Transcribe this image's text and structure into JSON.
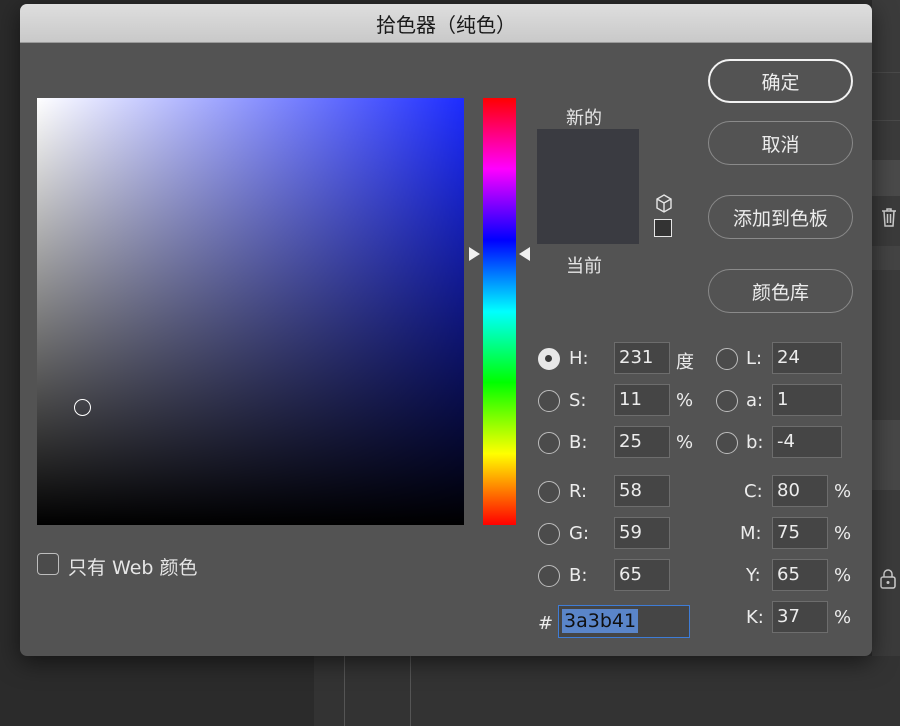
{
  "dialog": {
    "title": "拾色器（纯色）",
    "preview": {
      "new_label": "新的",
      "current_label": "当前",
      "new_color": "#3a3b41"
    },
    "buttons": {
      "ok": "确定",
      "cancel": "取消",
      "add_to_swatches": "添加到色板",
      "color_libraries": "颜色库"
    },
    "hsb": {
      "h": {
        "label": "H:",
        "value": "231",
        "unit": "度",
        "selected": true
      },
      "s": {
        "label": "S:",
        "value": "11",
        "unit": "%"
      },
      "b": {
        "label": "B:",
        "value": "25",
        "unit": "%"
      }
    },
    "lab": {
      "l": {
        "label": "L:",
        "value": "24"
      },
      "a": {
        "label": "a:",
        "value": "1"
      },
      "b": {
        "label": "b:",
        "value": "-4"
      }
    },
    "rgb": {
      "r": {
        "label": "R:",
        "value": "58"
      },
      "g": {
        "label": "G:",
        "value": "59"
      },
      "b": {
        "label": "B:",
        "value": "65"
      }
    },
    "cmyk": {
      "c": {
        "label": "C:",
        "value": "80",
        "unit": "%"
      },
      "m": {
        "label": "M:",
        "value": "75",
        "unit": "%"
      },
      "y": {
        "label": "Y:",
        "value": "65",
        "unit": "%"
      },
      "k": {
        "label": "K:",
        "value": "37",
        "unit": "%"
      }
    },
    "hex": {
      "label": "#",
      "value": "3a3b41"
    },
    "web_only": {
      "label": "只有 Web 颜色",
      "checked": false
    }
  },
  "icons": {
    "gamut": "cube-icon",
    "websafe": "square-icon",
    "trash": "trash-icon",
    "lock": "lock-icon"
  }
}
